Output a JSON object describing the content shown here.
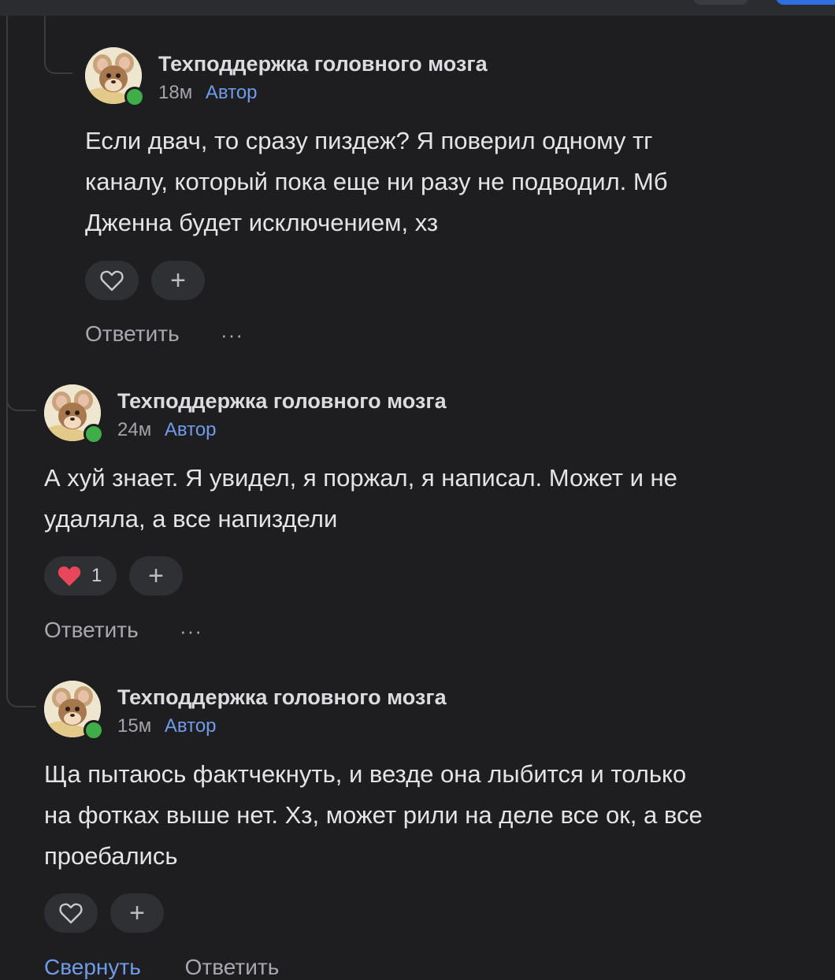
{
  "comments": [
    {
      "author": "Техподдержка головного мозга",
      "time": "18м",
      "role": "Автор",
      "text": "Если двач, то сразу пиздеж? Я поверил одному тг\nканалу, который пока еще ни разу не подводил. Мб\nДженна будет исключением, хз",
      "like_count": "",
      "liked": false,
      "add_label": "+",
      "reply_label": "Ответить",
      "more_label": "···"
    },
    {
      "author": "Техподдержка головного мозга",
      "time": "24м",
      "role": "Автор",
      "text": "А хуй знает. Я увидел, я поржал, я написал. Может и не\nудаляла, а все напиздели",
      "like_count": "1",
      "liked": true,
      "add_label": "+",
      "reply_label": "Ответить",
      "more_label": "···"
    },
    {
      "author": "Техподдержка головного мозга",
      "time": "15м",
      "role": "Автор",
      "text": "Ща пытаюсь фактчекнуть, и везде она лыбится и только\nна фотках выше нет. Хз, может рили на деле все ок, а все\nпроебались",
      "like_count": "",
      "liked": false,
      "add_label": "+",
      "reply_label": "",
      "more_label": ""
    }
  ],
  "footer": {
    "collapse_label": "Свернуть",
    "reply_label": "Ответить"
  },
  "colors": {
    "background": "#1e1e20",
    "accent": "#6f9be8",
    "online": "#3fae49",
    "heart": "#e8465a"
  },
  "icons": [
    "heart-icon",
    "plus-icon",
    "more-icon",
    "avatar-image"
  ]
}
